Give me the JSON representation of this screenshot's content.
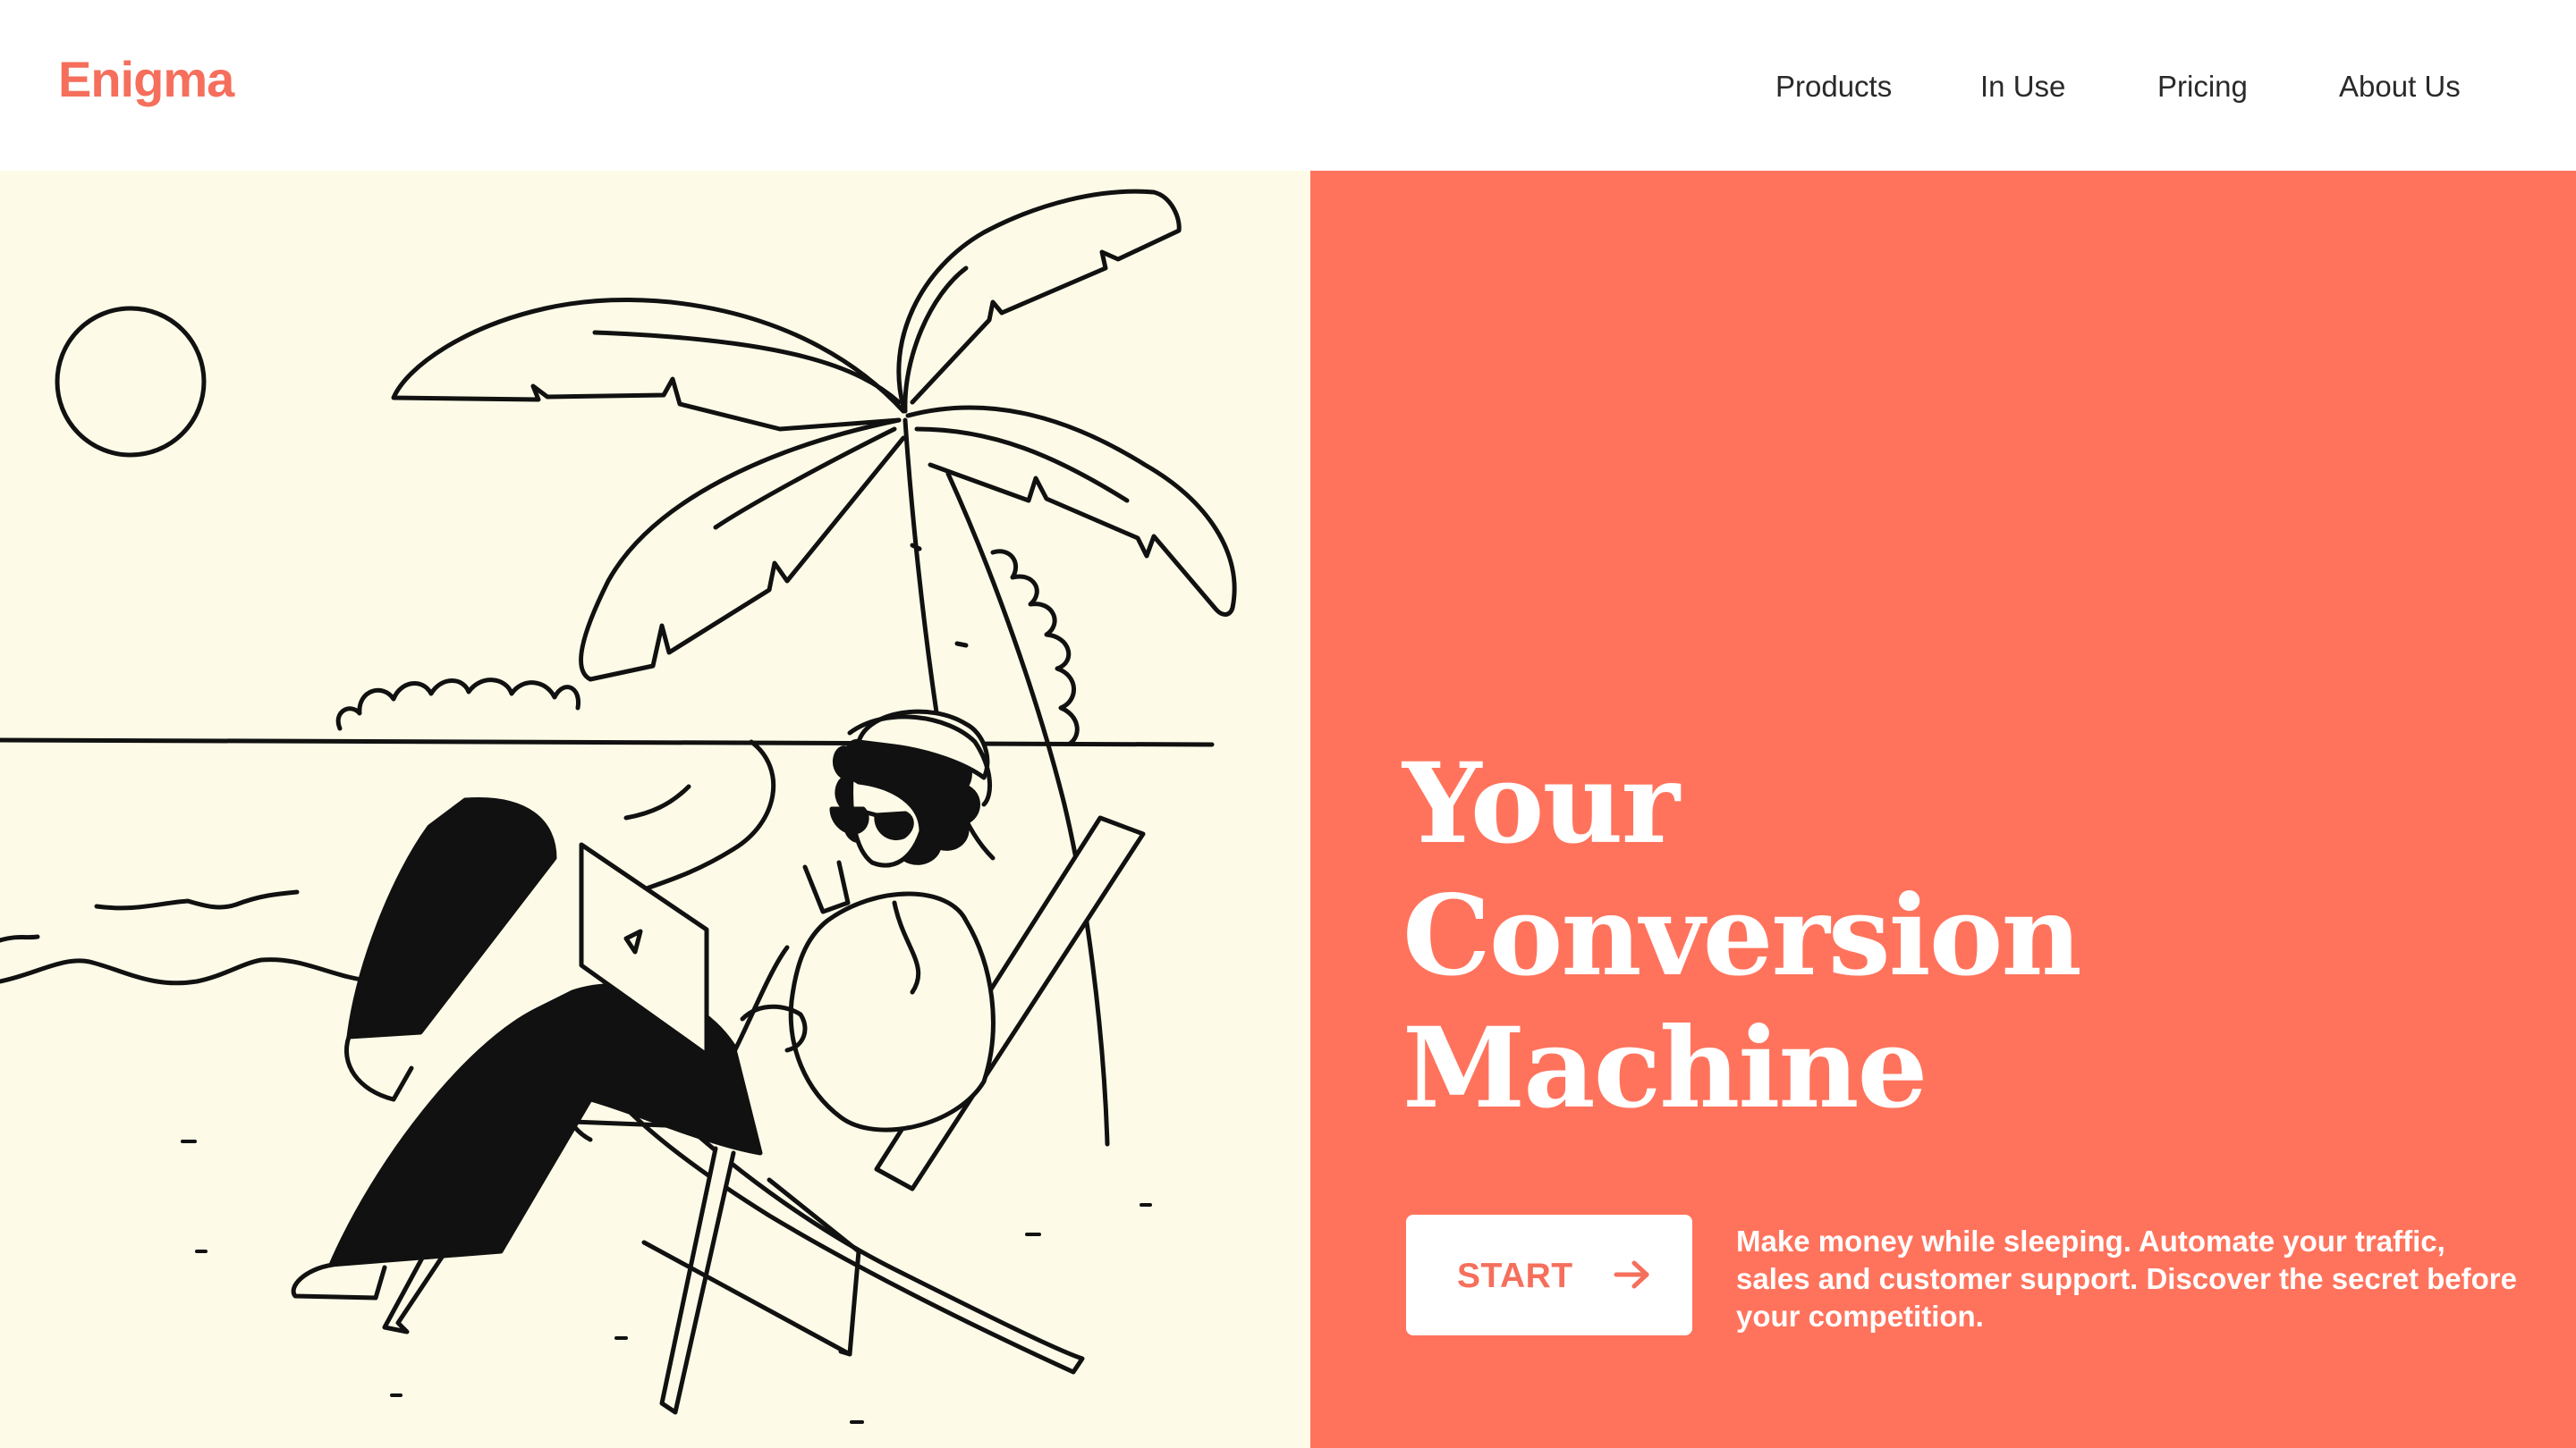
{
  "brand": {
    "name": "Enigma",
    "accent_color": "#f56f5c"
  },
  "nav": {
    "items": [
      {
        "label": "Products"
      },
      {
        "label": "In Use"
      },
      {
        "label": "Pricing"
      },
      {
        "label": "About Us"
      }
    ]
  },
  "hero": {
    "headline_lines": [
      "Your",
      "Conversion",
      "Machine"
    ],
    "cta": {
      "label": "START",
      "icon": "arrow-right-icon"
    },
    "tagline": "Make money while sleeping. Automate your traffic, sales and customer support. Discover the secret before your competition.",
    "panel_color": "#ff735d",
    "illustration_background": "#fdfbe7",
    "illustration": "beach-illustration"
  }
}
